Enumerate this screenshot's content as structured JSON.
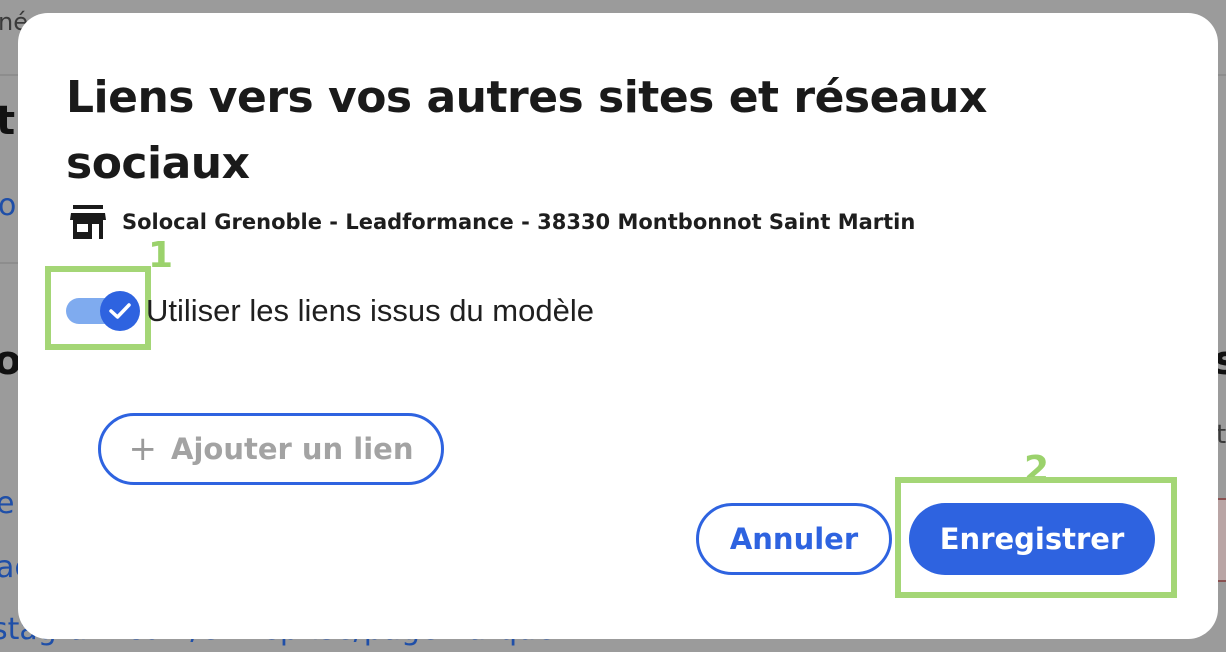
{
  "background": {
    "fragments": [
      "né",
      "tr",
      "o",
      "o",
      "e",
      "ac",
      "stagram.com/entreprise/pagemarque",
      "s",
      "t",
      "g"
    ]
  },
  "modal": {
    "title": "Liens vers vos autres sites et réseaux sociaux",
    "location_icon": "store-icon",
    "location": "Solocal Grenoble - Leadformance - 38330 Montbonnot Saint Martin",
    "toggle": {
      "label": "Utiliser les liens issus du modèle",
      "checked": true
    },
    "add_link_label": "Ajouter un lien",
    "cancel_label": "Annuler",
    "save_label": "Enregistrer"
  },
  "annotations": {
    "marker1": "1",
    "marker2": "2",
    "color": "#a4d676"
  },
  "colors": {
    "primary": "#2e63e0",
    "toggle_track": "#7fabef"
  }
}
